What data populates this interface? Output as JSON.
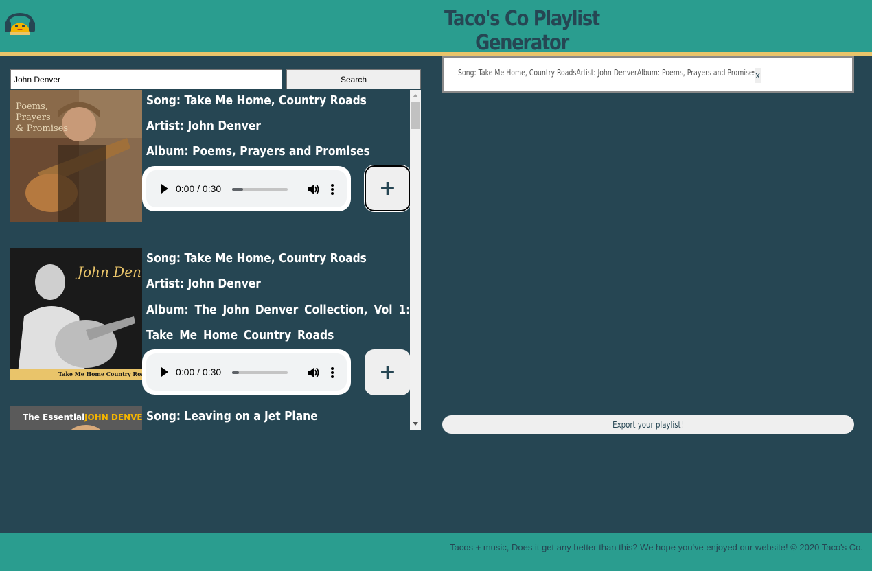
{
  "header": {
    "title": "Taco's Co Playlist Generator",
    "logo_icon": "taco-headphones-icon"
  },
  "search": {
    "value": "John Denver",
    "button_label": "Search"
  },
  "results": [
    {
      "song": "Song: Take Me Home, Country Roads",
      "artist": "Artist: John Denver",
      "album": "Album: Poems, Prayers and Promises",
      "player_time": "0:00 / 0:30",
      "progress": 0.2,
      "add_label": "+"
    },
    {
      "song": "Song: Take Me Home, Country Roads",
      "artist": "Artist: John Denver",
      "album": "Album: The John Denver Collection, Vol 1: Take Me Home Country Roads",
      "cover_text": "Take Me Home Country Roads",
      "cover_script": "John Denver",
      "player_time": "0:00 / 0:30",
      "progress": 0.12,
      "add_label": "+"
    },
    {
      "song": "Song: Leaving on a Jet Plane",
      "cover_text": "The Essential",
      "cover_artist": "JOHN DENVER"
    }
  ],
  "playlist": {
    "items": [
      {
        "text": "Song: Take Me Home, Country RoadsArtist: John DenverAlbum: Poems, Prayers and Promises",
        "remove_label": "x"
      }
    ]
  },
  "export_label": "Export your playlist!",
  "footer": {
    "text": "Tacos + music, Does it get any better than this? We hope you've enjoyed our website! © 2020 Taco's Co."
  },
  "colors": {
    "header": "#2a9d8f",
    "background": "#264653",
    "accent": "#e9c46a",
    "text_dark": "#264653"
  }
}
